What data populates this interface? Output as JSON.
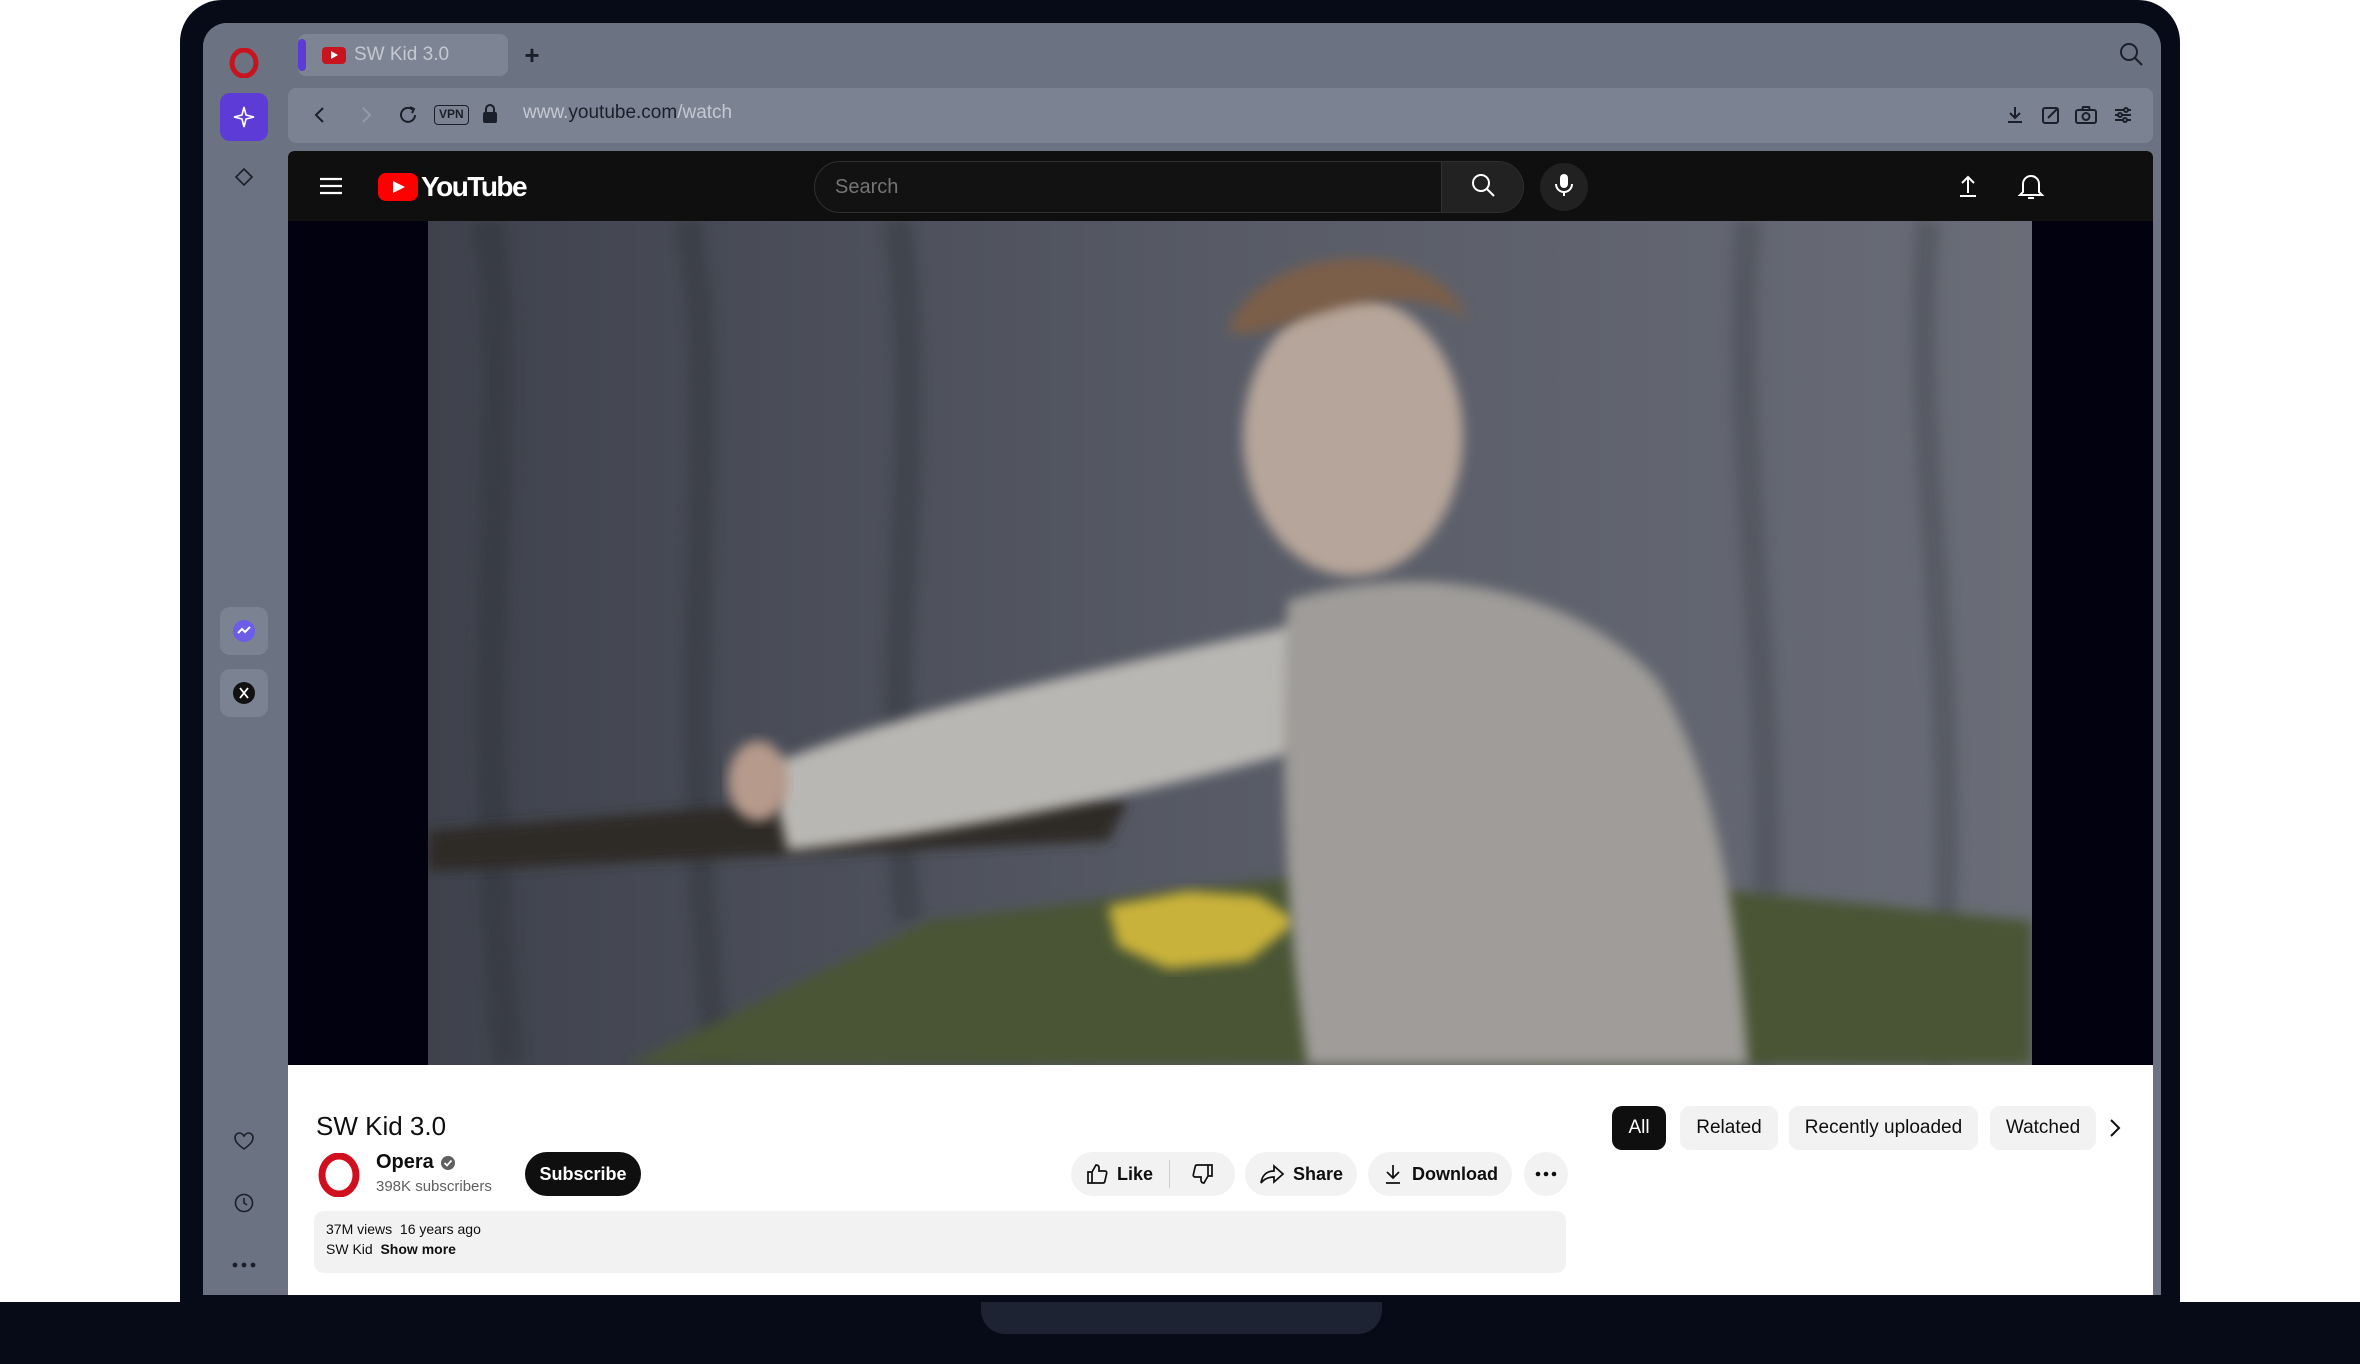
{
  "browser": {
    "tab_title": "SW Kid 3.0",
    "url_prefix": "www.",
    "url_domain": "youtube.com",
    "url_path": "/watch",
    "vpn_label": "VPN"
  },
  "youtube": {
    "logo_text": "YouTube",
    "search_placeholder": "Search"
  },
  "video": {
    "title": "SW Kid 3.0",
    "channel_name": "Opera",
    "subscribers": "398K subscribers",
    "subscribe_label": "Subscribe",
    "like_label": "Like",
    "share_label": "Share",
    "download_label": "Download",
    "views": "37M views",
    "age": "16 years ago",
    "description": "SW Kid",
    "show_more": "Show more"
  },
  "filters": {
    "all": "All",
    "related": "Related",
    "recent": "Recently uploaded",
    "watched": "Watched"
  },
  "colors": {
    "brand_red": "#ff0000",
    "opera_red": "#d0101e",
    "accent_purple": "#5c3bd6"
  }
}
